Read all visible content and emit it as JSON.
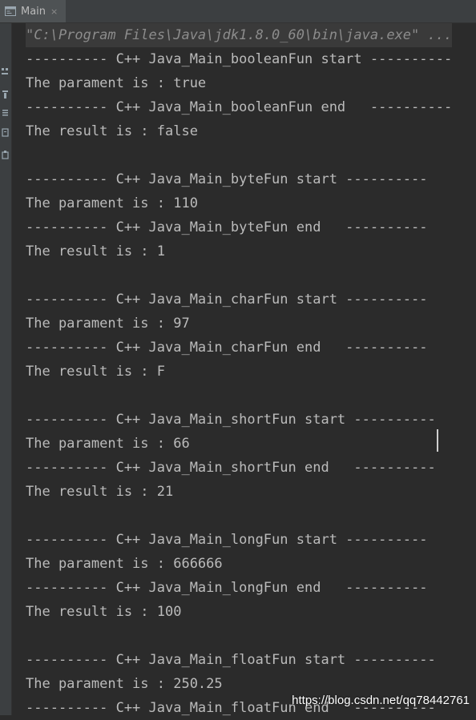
{
  "tab": {
    "label": "Main",
    "close": "×",
    "icon": "console-window-icon"
  },
  "gutter_icons": [
    "rerun-icon",
    "stop-icon",
    "pause-icon",
    "scroll-to-end-icon",
    "print-icon"
  ],
  "console": {
    "command": "\"C:\\Program Files\\Java\\jdk1.8.0_60\\bin\\java.exe\" ...",
    "lines": [
      "---------- C++ Java_Main_booleanFun start ----------",
      "The parament is : true",
      "---------- C++ Java_Main_booleanFun end   ----------",
      "The result is : false",
      "",
      "---------- C++ Java_Main_byteFun start ----------",
      "The parament is : 110",
      "---------- C++ Java_Main_byteFun end   ----------",
      "The result is : 1",
      "",
      "---------- C++ Java_Main_charFun start ----------",
      "The parament is : 97",
      "---------- C++ Java_Main_charFun end   ----------",
      "The result is : F",
      "",
      "---------- C++ Java_Main_shortFun start ----------",
      "The parament is : 66",
      "---------- C++ Java_Main_shortFun end   ----------",
      "The result is : 21",
      "",
      "---------- C++ Java_Main_longFun start ----------",
      "The parament is : 666666",
      "---------- C++ Java_Main_longFun end   ----------",
      "The result is : 100",
      "",
      "---------- C++ Java_Main_floatFun start ----------",
      "The parament is : 250.25",
      "---------- C++ Java_Main_floatFun end   ----------"
    ]
  },
  "watermark": "https://blog.csdn.net/qq78442761",
  "colors": {
    "background": "#2b2b2b",
    "tabbar": "#3c3f41",
    "text": "#bbbbbb",
    "command_text": "#8c8c8c"
  }
}
